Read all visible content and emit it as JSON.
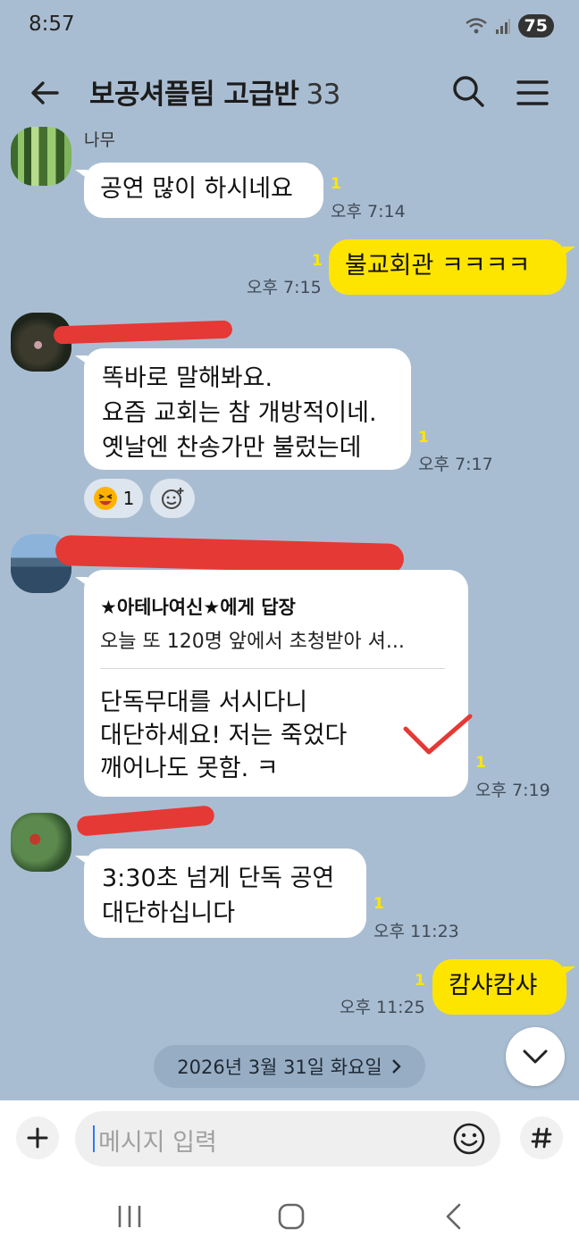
{
  "status_bar": {
    "time": "8:57",
    "battery": "75",
    "icons": [
      "wifi-icon",
      "signal-icon",
      "battery-icon"
    ]
  },
  "header": {
    "title": "보공셔플팀 고급반",
    "member_count": "33",
    "icons": [
      "back-arrow-icon",
      "search-icon",
      "menu-icon"
    ]
  },
  "messages": [
    {
      "sender": "나무",
      "text": "공연 많이 하시네요",
      "unread": "1",
      "time": "오후 7:14"
    },
    {
      "mine": true,
      "text": "불교회관 ㅋㅋㅋㅋ",
      "unread": "1",
      "time": "오후 7:15"
    },
    {
      "text": "똑바로 말해봐요.\n요즘 교회는 참 개방적이네.\n옛날엔 찬송가만 불렀는데",
      "unread": "1",
      "time": "오후 7:17",
      "reaction_count": "1"
    },
    {
      "reply_to": "★아테나여신★에게 답장",
      "quoted": "오늘 또 120명 앞에서 초청받아 셔...",
      "text": "단독무대를 서시다니\n대단하세요! 저는 죽었다\n깨어나도 못함. ㅋ",
      "unread": "1",
      "time": "오후 7:19"
    },
    {
      "text": "3:30초 넘게 단독 공연\n대단하십니다",
      "unread": "1",
      "time": "오후 11:23"
    },
    {
      "mine": true,
      "text": "캄샤캄샤",
      "unread": "1",
      "time": "오후 11:25"
    }
  ],
  "date_divider": "2026년 3월 31일 화요일",
  "input": {
    "placeholder": "메시지 입력"
  },
  "colors": {
    "background": "#a9bdd2",
    "my_bubble": "#fee500",
    "other_bubble": "#ffffff",
    "unread": "#ffe600",
    "annotation_red": "#e53935"
  }
}
